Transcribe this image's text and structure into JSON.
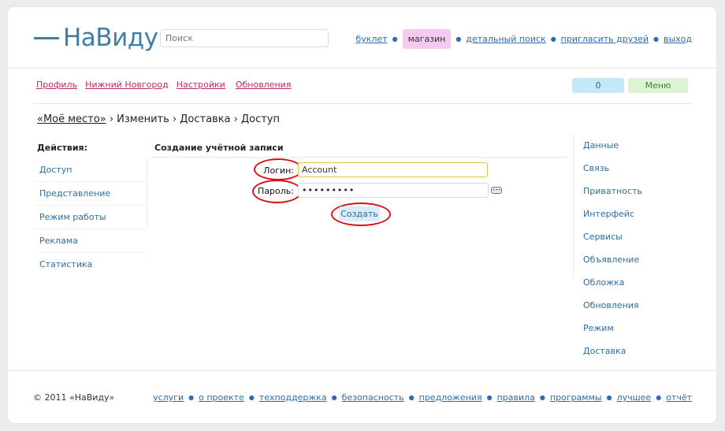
{
  "header": {
    "logo_text": "НаВиду",
    "search_placeholder": "Поиск",
    "nav": [
      "буклет",
      "магазин",
      "детальный поиск",
      "пригласить друзей",
      "выход"
    ]
  },
  "subnav": {
    "links": [
      "Профиль",
      "Нижний Новгород",
      "Настройки",
      "Обновления"
    ],
    "count_badge": "0",
    "menu_badge": "Меню"
  },
  "breadcrumb": {
    "home": "«Моё место»",
    "rest": " › Изменить › Доставка › Доступ"
  },
  "sidebar_left": {
    "title": "Действия:",
    "items": [
      "Доступ",
      "Представление",
      "Режим работы",
      "Реклама",
      "Статистика"
    ]
  },
  "form": {
    "title": "Создание учётной записи",
    "login_label": "Логин:",
    "login_value": "Account",
    "password_label": "Пароль:",
    "password_value": "•••••••••",
    "submit_label": "Создать"
  },
  "sidebar_right": {
    "items": [
      "Данные",
      "Связь",
      "Приватность",
      "Интерфейс",
      "Сервисы",
      "Объявление",
      "Обложка",
      "Обновления",
      "Режим",
      "Доставка"
    ]
  },
  "footer": {
    "copyright": "© 2011 «НаВиду»",
    "links": [
      "услуги",
      "о проекте",
      "техподдержка",
      "безопасность",
      "предложения",
      "правила",
      "программы",
      "лучшее",
      "отчёт"
    ]
  },
  "colors": {
    "accent_blue": "#3f7ea6",
    "link_blue": "#2c6cb0",
    "subnav_pink": "#c22a66",
    "shop_bg": "#f7c8f0",
    "annotation_red": "#dd1111"
  }
}
